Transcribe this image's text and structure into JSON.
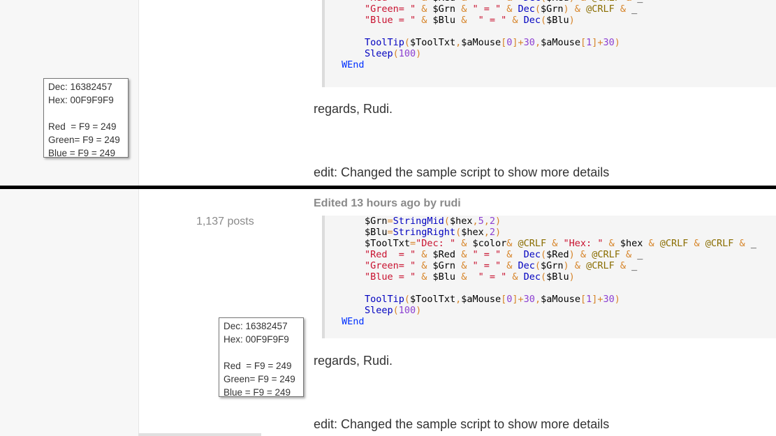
{
  "posts": [
    {
      "post_count": "",
      "edited": "",
      "code_lines": [
        [
          {
            "t": "\"Red  = \"",
            "c": "s"
          },
          {
            "t": " & ",
            "c": "o"
          },
          {
            "t": "$Red",
            "c": "v"
          },
          {
            "t": " & ",
            "c": "o"
          },
          {
            "t": "\" = \"",
            "c": "s"
          },
          {
            "t": " & ",
            "c": "o"
          },
          {
            "t": " Dec",
            "c": "f"
          },
          {
            "t": "(",
            "c": "o"
          },
          {
            "t": "$Red",
            "c": "v"
          },
          {
            "t": ")",
            "c": "o"
          },
          {
            "t": " & ",
            "c": "o"
          },
          {
            "t": "@CRLF",
            "c": "m"
          },
          {
            "t": " & ",
            "c": "o"
          },
          {
            "t": "_",
            "c": "v"
          }
        ],
        [
          {
            "t": "\"Green= \"",
            "c": "s"
          },
          {
            "t": " & ",
            "c": "o"
          },
          {
            "t": "$Grn",
            "c": "v"
          },
          {
            "t": " & ",
            "c": "o"
          },
          {
            "t": "\" = \"",
            "c": "s"
          },
          {
            "t": " & ",
            "c": "o"
          },
          {
            "t": "Dec",
            "c": "f"
          },
          {
            "t": "(",
            "c": "o"
          },
          {
            "t": "$Grn",
            "c": "v"
          },
          {
            "t": ")",
            "c": "o"
          },
          {
            "t": " & ",
            "c": "o"
          },
          {
            "t": "@CRLF",
            "c": "m"
          },
          {
            "t": " & ",
            "c": "o"
          },
          {
            "t": "_",
            "c": "v"
          }
        ],
        [
          {
            "t": "\"Blue = \"",
            "c": "s"
          },
          {
            "t": " & ",
            "c": "o"
          },
          {
            "t": "$Blu",
            "c": "v"
          },
          {
            "t": " &  ",
            "c": "o"
          },
          {
            "t": "\" = \"",
            "c": "s"
          },
          {
            "t": " & ",
            "c": "o"
          },
          {
            "t": "Dec",
            "c": "f"
          },
          {
            "t": "(",
            "c": "o"
          },
          {
            "t": "$Blu",
            "c": "v"
          },
          {
            "t": ")",
            "c": "o"
          }
        ],
        [],
        [
          {
            "t": "ToolTip",
            "c": "f"
          },
          {
            "t": "(",
            "c": "o"
          },
          {
            "t": "$ToolTxt",
            "c": "v"
          },
          {
            "t": ",",
            "c": "o"
          },
          {
            "t": "$aMouse",
            "c": "v"
          },
          {
            "t": "[",
            "c": "o"
          },
          {
            "t": "0",
            "c": "n"
          },
          {
            "t": "]+",
            "c": "o"
          },
          {
            "t": "30",
            "c": "n"
          },
          {
            "t": ",",
            "c": "o"
          },
          {
            "t": "$aMouse",
            "c": "v"
          },
          {
            "t": "[",
            "c": "o"
          },
          {
            "t": "1",
            "c": "n"
          },
          {
            "t": "]+",
            "c": "o"
          },
          {
            "t": "30",
            "c": "n"
          },
          {
            "t": ")",
            "c": "o"
          }
        ],
        [
          {
            "t": "Sleep",
            "c": "f"
          },
          {
            "t": "(",
            "c": "o"
          },
          {
            "t": "100",
            "c": "n"
          },
          {
            "t": ")",
            "c": "o"
          }
        ],
        [
          {
            "t": "WEnd",
            "c": "k"
          }
        ]
      ],
      "code_indent": [
        2,
        2,
        2,
        2,
        2,
        2,
        1
      ],
      "regards": "regards, Rudi.",
      "edit_note": "edit: Changed the sample script to show more details",
      "tooltip": {
        "dec": "Dec: 16382457",
        "hex": "Hex: 00F9F9F9",
        "red": "Red  = F9 = 249",
        "green": "Green= F9 = 249",
        "blue": "Blue = F9 = 249"
      }
    },
    {
      "post_count": "1,137 posts",
      "edited": "Edited 13 hours ago by rudi",
      "code_lines": [
        [
          {
            "t": "$Grn",
            "c": "v"
          },
          {
            "t": "=",
            "c": "o"
          },
          {
            "t": "StringMid",
            "c": "f"
          },
          {
            "t": "(",
            "c": "o"
          },
          {
            "t": "$hex",
            "c": "v"
          },
          {
            "t": ",",
            "c": "o"
          },
          {
            "t": "5",
            "c": "n"
          },
          {
            "t": ",",
            "c": "o"
          },
          {
            "t": "2",
            "c": "n"
          },
          {
            "t": ")",
            "c": "o"
          }
        ],
        [
          {
            "t": "$Blu",
            "c": "v"
          },
          {
            "t": "=",
            "c": "o"
          },
          {
            "t": "StringRight",
            "c": "f"
          },
          {
            "t": "(",
            "c": "o"
          },
          {
            "t": "$hex",
            "c": "v"
          },
          {
            "t": ",",
            "c": "o"
          },
          {
            "t": "2",
            "c": "n"
          },
          {
            "t": ")",
            "c": "o"
          }
        ],
        [
          {
            "t": "$ToolTxt",
            "c": "v"
          },
          {
            "t": "=",
            "c": "o"
          },
          {
            "t": "\"Dec: \"",
            "c": "s"
          },
          {
            "t": " & ",
            "c": "o"
          },
          {
            "t": "$color",
            "c": "v"
          },
          {
            "t": "& ",
            "c": "o"
          },
          {
            "t": "@CRLF",
            "c": "m"
          },
          {
            "t": " & ",
            "c": "o"
          },
          {
            "t": "\"Hex: \"",
            "c": "s"
          },
          {
            "t": " & ",
            "c": "o"
          },
          {
            "t": "$hex",
            "c": "v"
          },
          {
            "t": " & ",
            "c": "o"
          },
          {
            "t": "@CRLF",
            "c": "m"
          },
          {
            "t": " & ",
            "c": "o"
          },
          {
            "t": "@CRLF",
            "c": "m"
          },
          {
            "t": " & ",
            "c": "o"
          },
          {
            "t": "_",
            "c": "v"
          }
        ],
        [
          {
            "t": "\"Red  = \"",
            "c": "s"
          },
          {
            "t": " & ",
            "c": "o"
          },
          {
            "t": "$Red",
            "c": "v"
          },
          {
            "t": " & ",
            "c": "o"
          },
          {
            "t": "\" = \"",
            "c": "s"
          },
          {
            "t": " & ",
            "c": "o"
          },
          {
            "t": " Dec",
            "c": "f"
          },
          {
            "t": "(",
            "c": "o"
          },
          {
            "t": "$Red",
            "c": "v"
          },
          {
            "t": ")",
            "c": "o"
          },
          {
            "t": " & ",
            "c": "o"
          },
          {
            "t": "@CRLF",
            "c": "m"
          },
          {
            "t": " & ",
            "c": "o"
          },
          {
            "t": "_",
            "c": "v"
          }
        ],
        [
          {
            "t": "\"Green= \"",
            "c": "s"
          },
          {
            "t": " & ",
            "c": "o"
          },
          {
            "t": "$Grn",
            "c": "v"
          },
          {
            "t": " & ",
            "c": "o"
          },
          {
            "t": "\" = \"",
            "c": "s"
          },
          {
            "t": " & ",
            "c": "o"
          },
          {
            "t": "Dec",
            "c": "f"
          },
          {
            "t": "(",
            "c": "o"
          },
          {
            "t": "$Grn",
            "c": "v"
          },
          {
            "t": ")",
            "c": "o"
          },
          {
            "t": " & ",
            "c": "o"
          },
          {
            "t": "@CRLF",
            "c": "m"
          },
          {
            "t": " & ",
            "c": "o"
          },
          {
            "t": "_",
            "c": "v"
          }
        ],
        [
          {
            "t": "\"Blue = \"",
            "c": "s"
          },
          {
            "t": " & ",
            "c": "o"
          },
          {
            "t": "$Blu",
            "c": "v"
          },
          {
            "t": " &  ",
            "c": "o"
          },
          {
            "t": "\" = \"",
            "c": "s"
          },
          {
            "t": " & ",
            "c": "o"
          },
          {
            "t": "Dec",
            "c": "f"
          },
          {
            "t": "(",
            "c": "o"
          },
          {
            "t": "$Blu",
            "c": "v"
          },
          {
            "t": ")",
            "c": "o"
          }
        ],
        [],
        [
          {
            "t": "ToolTip",
            "c": "f"
          },
          {
            "t": "(",
            "c": "o"
          },
          {
            "t": "$ToolTxt",
            "c": "v"
          },
          {
            "t": ",",
            "c": "o"
          },
          {
            "t": "$aMouse",
            "c": "v"
          },
          {
            "t": "[",
            "c": "o"
          },
          {
            "t": "0",
            "c": "n"
          },
          {
            "t": "]+",
            "c": "o"
          },
          {
            "t": "30",
            "c": "n"
          },
          {
            "t": ",",
            "c": "o"
          },
          {
            "t": "$aMouse",
            "c": "v"
          },
          {
            "t": "[",
            "c": "o"
          },
          {
            "t": "1",
            "c": "n"
          },
          {
            "t": "]+",
            "c": "o"
          },
          {
            "t": "30",
            "c": "n"
          },
          {
            "t": ")",
            "c": "o"
          }
        ],
        [
          {
            "t": "Sleep",
            "c": "f"
          },
          {
            "t": "(",
            "c": "o"
          },
          {
            "t": "100",
            "c": "n"
          },
          {
            "t": ")",
            "c": "o"
          }
        ],
        [
          {
            "t": "WEnd",
            "c": "k"
          }
        ]
      ],
      "code_indent": [
        2,
        2,
        2,
        2,
        2,
        2,
        2,
        2,
        2,
        1
      ],
      "regards": "regards, Rudi.",
      "edit_note": "edit: Changed the sample script to show more details",
      "tooltip": {
        "dec": "Dec: 16382457",
        "hex": "Hex: 00F9F9F9",
        "red": "Red  = F9 = 249",
        "green": "Green= F9 = 249",
        "blue": "Blue = F9 = 249"
      }
    }
  ]
}
